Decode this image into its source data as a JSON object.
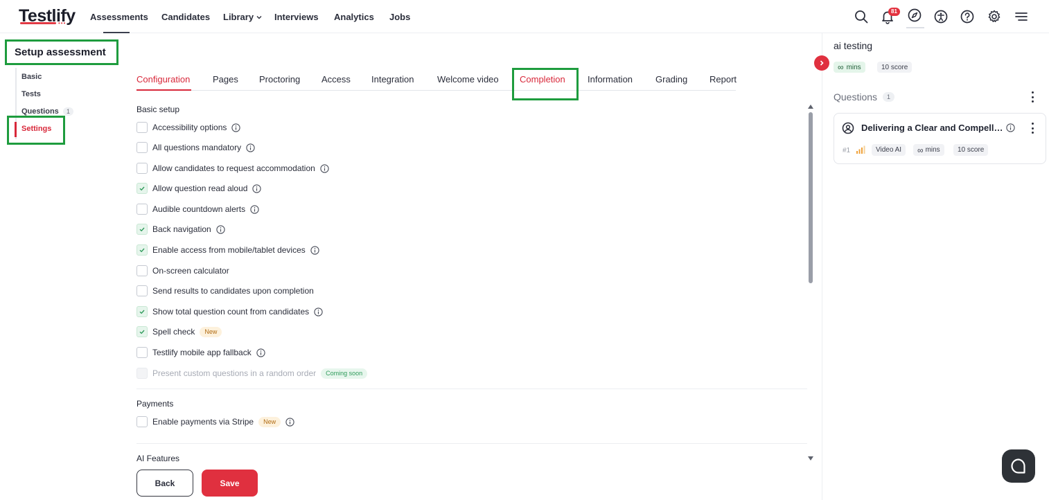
{
  "brand": {
    "logo_text": "Testlify"
  },
  "nav": {
    "assessments": "Assessments",
    "candidates": "Candidates",
    "library": "Library",
    "interviews": "Interviews",
    "analytics": "Analytics",
    "jobs": "Jobs"
  },
  "header_icons": {
    "search": "search-icon",
    "notifications": "bell-icon",
    "notification_count": "81",
    "explore": "compass-icon",
    "accessibility": "accessibility-icon",
    "help": "help-icon",
    "settings": "gear-icon",
    "menu": "menu-icon"
  },
  "sidebar": {
    "title": "Setup assessment",
    "items": [
      {
        "label": "Basic"
      },
      {
        "label": "Tests"
      },
      {
        "label": "Questions",
        "count": "1"
      },
      {
        "label": "Settings",
        "active": true
      }
    ]
  },
  "tabs": [
    {
      "label": "Configuration",
      "active": true
    },
    {
      "label": "Pages"
    },
    {
      "label": "Proctoring"
    },
    {
      "label": "Access"
    },
    {
      "label": "Integration"
    },
    {
      "label": "Welcome video"
    },
    {
      "label": "Completion",
      "highlighted": true
    },
    {
      "label": "Information"
    },
    {
      "label": "Grading"
    },
    {
      "label": "Report"
    }
  ],
  "basic_setup": {
    "title": "Basic setup",
    "options": [
      {
        "label": "Accessibility options",
        "checked": false,
        "info": true
      },
      {
        "label": "All questions mandatory",
        "checked": false,
        "info": true
      },
      {
        "label": "Allow candidates to request accommodation",
        "checked": false,
        "info": true
      },
      {
        "label": "Allow question read aloud",
        "checked": true,
        "info": true
      },
      {
        "label": "Audible countdown alerts",
        "checked": false,
        "info": true
      },
      {
        "label": "Back navigation",
        "checked": true,
        "info": true
      },
      {
        "label": "Enable access from mobile/tablet devices",
        "checked": true,
        "info": true
      },
      {
        "label": "On-screen calculator",
        "checked": false,
        "info": false
      },
      {
        "label": "Send results to candidates upon completion",
        "checked": false,
        "info": false
      },
      {
        "label": "Show total question count from candidates",
        "checked": true,
        "info": true
      },
      {
        "label": "Spell check",
        "checked": true,
        "info": false,
        "badge": "New"
      },
      {
        "label": "Testlify mobile app fallback",
        "checked": false,
        "info": true
      },
      {
        "label": "Present custom questions in a random order",
        "checked": false,
        "disabled": true,
        "badge_soon": "Coming soon"
      }
    ]
  },
  "payments": {
    "title": "Payments",
    "option": {
      "label": "Enable payments via Stripe",
      "checked": false,
      "badge": "New",
      "info": true
    }
  },
  "ai_features": {
    "title": "AI Features"
  },
  "actions": {
    "back": "Back",
    "save": "Save"
  },
  "right_panel": {
    "title": "ai testing",
    "duration": "mins",
    "score": "10 score",
    "questions_label": "Questions",
    "questions_count": "1",
    "question": {
      "title": "Delivering a Clear and Compelling Presentation",
      "number": "#1",
      "type": "Video AI",
      "duration": "mins",
      "score": "10 score"
    }
  },
  "colors": {
    "accent": "#d8283a",
    "save_button": "#e0303f",
    "highlight_box": "#1e9c3e",
    "checked_fill": "#e6f5ec"
  }
}
